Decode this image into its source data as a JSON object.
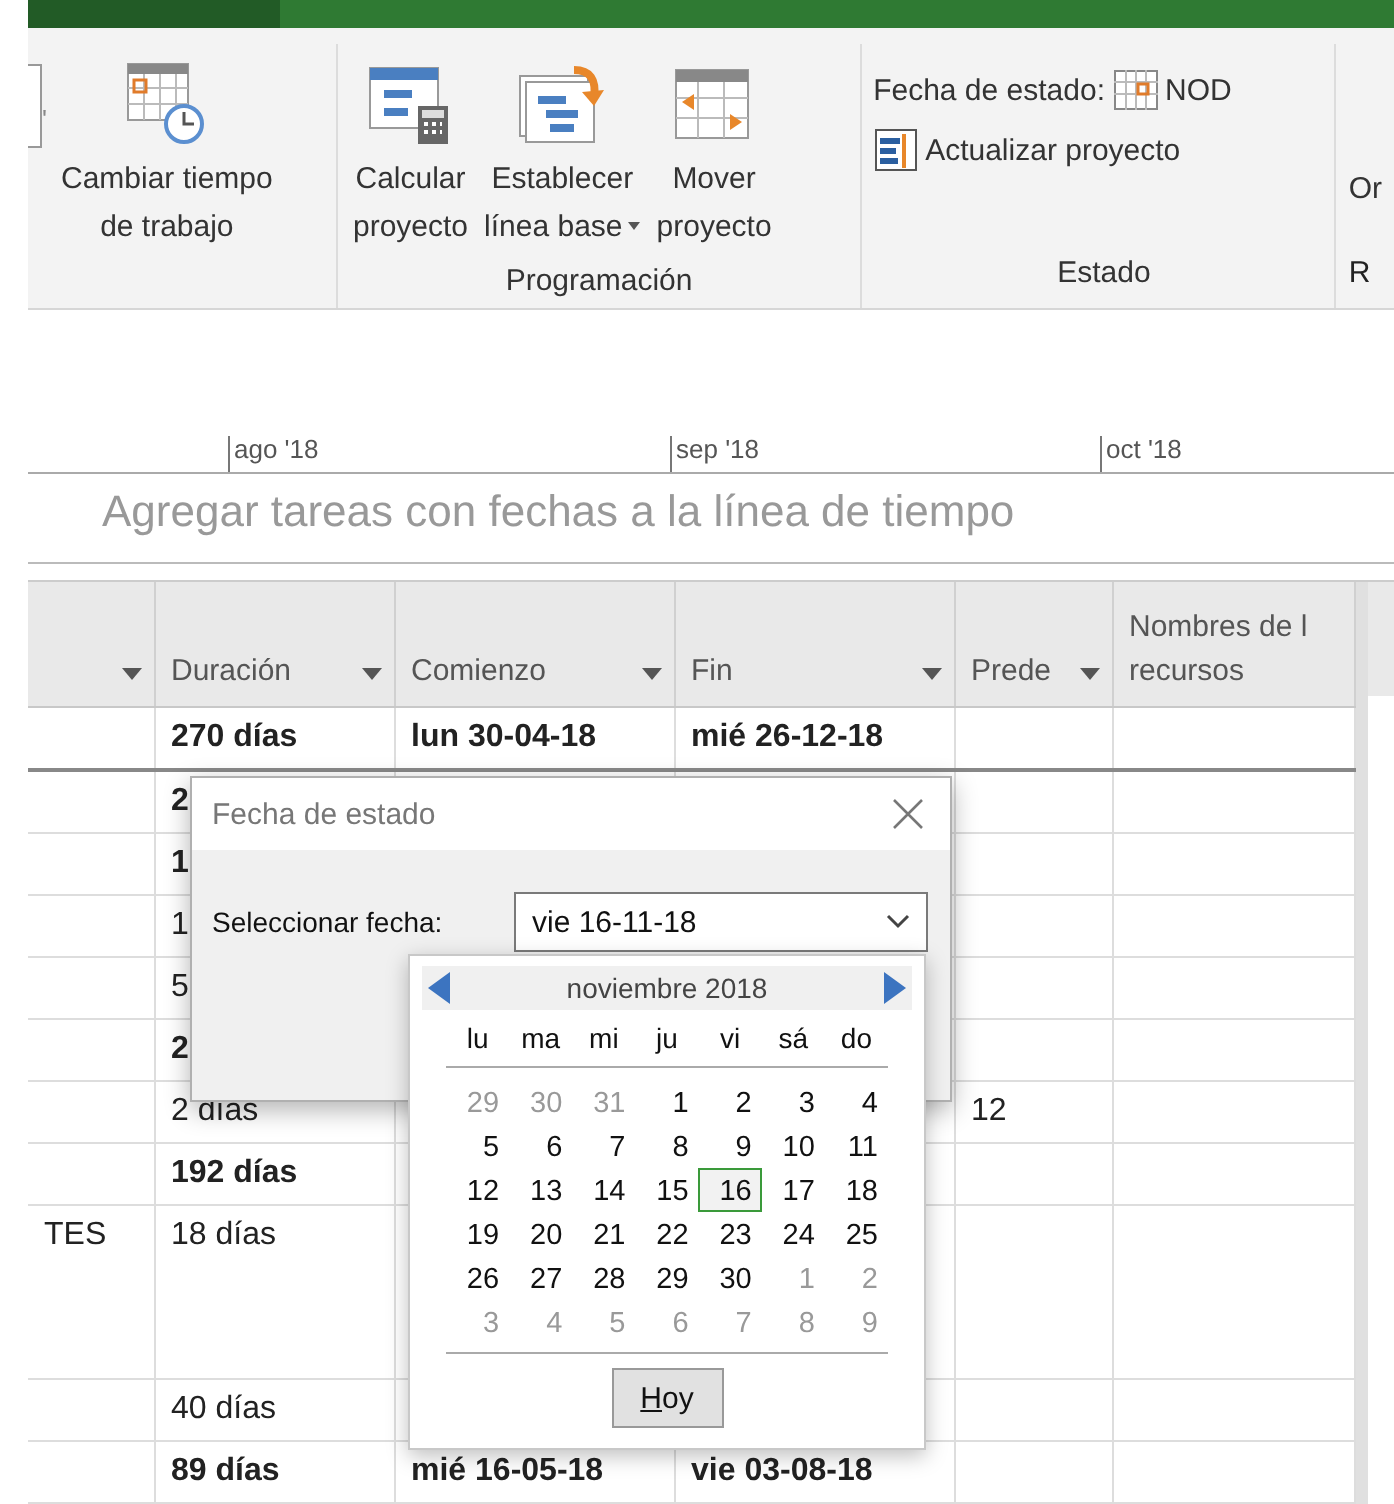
{
  "ribbon": {
    "partial_glyph": "'",
    "groups": [
      {
        "buttons": [
          {
            "kind": "calendar-clock",
            "lines": [
              "Cambiar tiempo",
              "de trabajo"
            ],
            "dropdown": false
          }
        ]
      },
      {
        "label": "Programación",
        "buttons": [
          {
            "kind": "calculate",
            "lines": [
              "Calcular",
              "proyecto"
            ],
            "dropdown": false
          },
          {
            "kind": "baseline",
            "lines": [
              "Establecer",
              "línea base"
            ],
            "dropdown": true
          },
          {
            "kind": "move",
            "lines": [
              "Mover",
              "proyecto"
            ],
            "dropdown": false
          }
        ]
      }
    ],
    "status_group": {
      "label": "Estado",
      "status_date_label": "Fecha de estado:",
      "status_date_value": "NOD",
      "update_label": "Actualizar proyecto"
    },
    "next_group": {
      "button": "Or",
      "label": "R"
    }
  },
  "timeline": {
    "ticks": [
      "ago '18",
      "sep '18",
      "oct '18"
    ],
    "placeholder": "Agregar tareas con fechas a la línea de tiempo"
  },
  "table": {
    "columns": [
      {
        "filter": true
      },
      {
        "label": "Duración",
        "filter": true
      },
      {
        "label": "Comienzo",
        "filter": true
      },
      {
        "label": "Fin",
        "filter": true
      },
      {
        "label": "Prede",
        "filter": true
      },
      {
        "label": "Nombres de l\nrecursos",
        "filter": false
      }
    ],
    "rows": [
      {
        "duration": "270 días",
        "start": "lun 30-04-18",
        "finish": "mié 26-12-18",
        "bold": true
      },
      {
        "duration": "2",
        "bold": true
      },
      {
        "duration": "1",
        "bold": true
      },
      {
        "duration": "1",
        "bold": false
      },
      {
        "duration": "5",
        "bold": false
      },
      {
        "duration": "2",
        "bold": true
      },
      {
        "duration": "2 días",
        "predecessors": "12",
        "bold": false
      },
      {
        "duration": "192 días",
        "bold": true
      },
      {
        "name": "TES",
        "duration": "18 días",
        "bold": false
      },
      {
        "duration": "40 días",
        "bold": false
      },
      {
        "duration": "89 días",
        "start": "mié 16-05-18",
        "finish": "vie 03-08-18",
        "bold": true
      }
    ]
  },
  "dialog": {
    "title": "Fecha de estado",
    "field_label": "Seleccionar fecha:",
    "value": "vie 16-11-18",
    "calendar": {
      "month": "noviembre 2018",
      "weekdays": [
        "lu",
        "ma",
        "mi",
        "ju",
        "vi",
        "sá",
        "do"
      ],
      "weeks": [
        [
          {
            "day": "29",
            "outside": true,
            "selected": false
          },
          {
            "day": "30",
            "outside": true,
            "selected": false
          },
          {
            "day": "31",
            "outside": true,
            "selected": false
          },
          {
            "day": "1",
            "outside": false,
            "selected": false
          },
          {
            "day": "2",
            "outside": false,
            "selected": false
          },
          {
            "day": "3",
            "outside": false,
            "selected": false
          },
          {
            "day": "4",
            "outside": false,
            "selected": false
          }
        ],
        [
          {
            "day": "5",
            "outside": false,
            "selected": false
          },
          {
            "day": "6",
            "outside": false,
            "selected": false
          },
          {
            "day": "7",
            "outside": false,
            "selected": false
          },
          {
            "day": "8",
            "outside": false,
            "selected": false
          },
          {
            "day": "9",
            "outside": false,
            "selected": false
          },
          {
            "day": "10",
            "outside": false,
            "selected": false
          },
          {
            "day": "11",
            "outside": false,
            "selected": false
          }
        ],
        [
          {
            "day": "12",
            "outside": false,
            "selected": false
          },
          {
            "day": "13",
            "outside": false,
            "selected": false
          },
          {
            "day": "14",
            "outside": false,
            "selected": false
          },
          {
            "day": "15",
            "outside": false,
            "selected": false
          },
          {
            "day": "16",
            "outside": false,
            "selected": true
          },
          {
            "day": "17",
            "outside": false,
            "selected": false
          },
          {
            "day": "18",
            "outside": false,
            "selected": false
          }
        ],
        [
          {
            "day": "19",
            "outside": false,
            "selected": false
          },
          {
            "day": "20",
            "outside": false,
            "selected": false
          },
          {
            "day": "21",
            "outside": false,
            "selected": false
          },
          {
            "day": "22",
            "outside": false,
            "selected": false
          },
          {
            "day": "23",
            "outside": false,
            "selected": false
          },
          {
            "day": "24",
            "outside": false,
            "selected": false
          },
          {
            "day": "25",
            "outside": false,
            "selected": false
          }
        ],
        [
          {
            "day": "26",
            "outside": false,
            "selected": false
          },
          {
            "day": "27",
            "outside": false,
            "selected": false
          },
          {
            "day": "28",
            "outside": false,
            "selected": false
          },
          {
            "day": "29",
            "outside": false,
            "selected": false
          },
          {
            "day": "30",
            "outside": false,
            "selected": false
          },
          {
            "day": "1",
            "outside": true,
            "selected": false
          },
          {
            "day": "2",
            "outside": true,
            "selected": false
          }
        ],
        [
          {
            "day": "3",
            "outside": true,
            "selected": false
          },
          {
            "day": "4",
            "outside": true,
            "selected": false
          },
          {
            "day": "5",
            "outside": true,
            "selected": false
          },
          {
            "day": "6",
            "outside": true,
            "selected": false
          },
          {
            "day": "7",
            "outside": true,
            "selected": false
          },
          {
            "day": "8",
            "outside": true,
            "selected": false
          },
          {
            "day": "9",
            "outside": true,
            "selected": false
          }
        ]
      ],
      "today_button": {
        "label": "Hoy",
        "access_key_underlined": true
      }
    }
  }
}
